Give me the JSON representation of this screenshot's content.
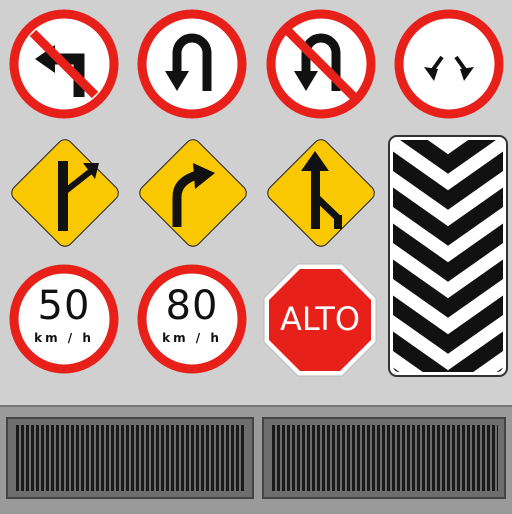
{
  "signs": {
    "no_left_turn": {
      "icon": "no-left-turn-icon"
    },
    "u_turn": {
      "icon": "u-turn-icon"
    },
    "no_u_turn": {
      "icon": "no-u-turn-icon"
    },
    "split_arrows": {
      "icon": "split-down-arrows-icon"
    },
    "side_road_right": {
      "icon": "side-road-right-icon"
    },
    "curve_right": {
      "icon": "curve-right-icon"
    },
    "merge_right": {
      "icon": "merge-right-icon"
    },
    "chevron_board": {
      "icon": "chevron-board-icon"
    },
    "speed_50": {
      "value": "50",
      "unit": "km / h"
    },
    "speed_80": {
      "value": "80",
      "unit": "km / h"
    },
    "stop": {
      "text": "ALTO"
    }
  },
  "colors": {
    "red": "#e8201a",
    "yellow": "#f9c800",
    "black": "#111111",
    "background": "#d0d0d0"
  }
}
